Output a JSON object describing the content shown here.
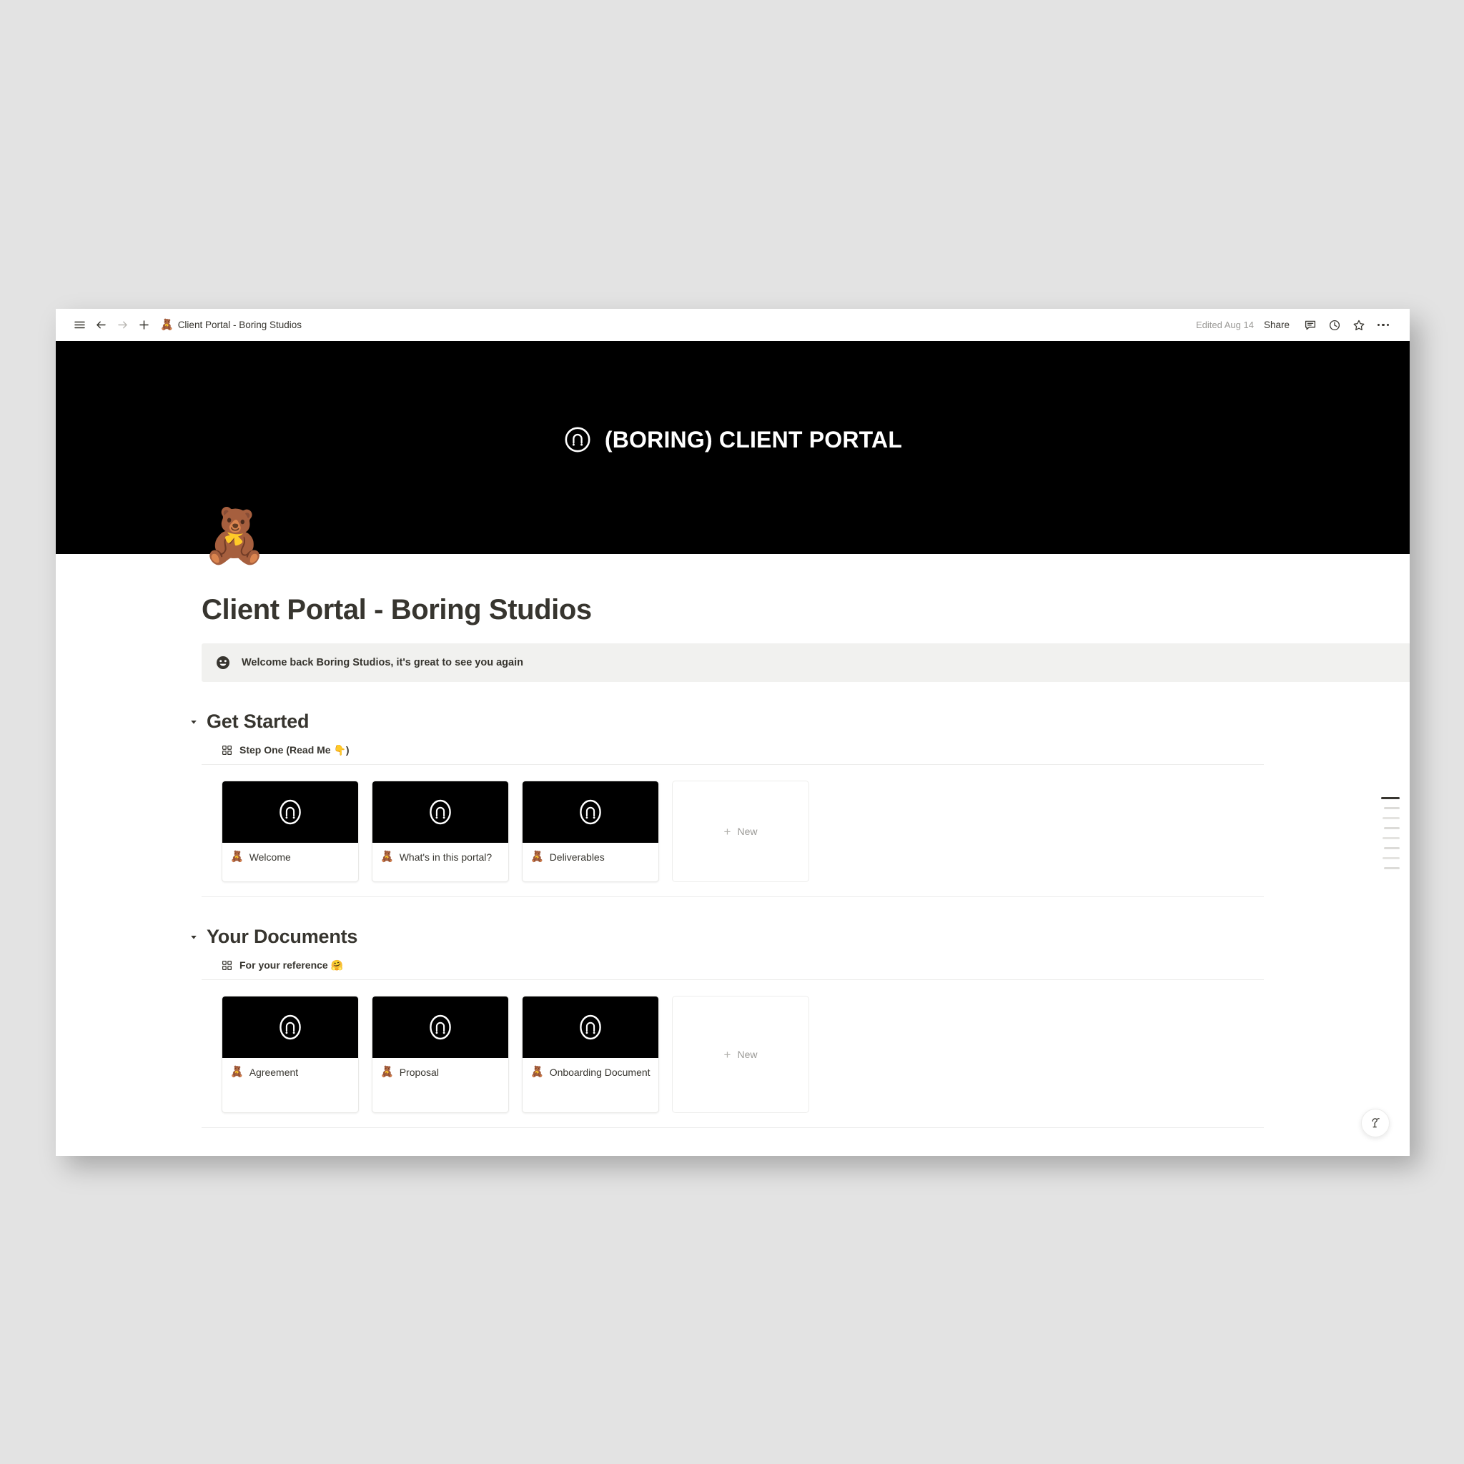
{
  "topbar": {
    "menu_icon": "hamburger-menu-icon",
    "back_icon": "arrow-left-icon",
    "forward_icon": "arrow-right-icon",
    "new_icon": "plus-icon",
    "breadcrumb_emoji": "🧸",
    "breadcrumb_title": "Client Portal - Boring Studios",
    "edited_label": "Edited Aug 14",
    "share_label": "Share",
    "comment_icon": "comment-icon",
    "history_icon": "clock-history-icon",
    "favorite_icon": "star-icon",
    "more_icon": "more-options-icon"
  },
  "cover": {
    "brand_title": "(BORING) CLIENT PORTAL",
    "logo_icon": "boring-studios-logo-icon",
    "background_color": "#000000"
  },
  "page": {
    "emoji": "🧸",
    "title": "Client Portal - Boring Studios",
    "callout": {
      "icon": "smiley-face-icon",
      "text": "Welcome back Boring Studios, it's great to see you again",
      "background_color": "#f1f1ef"
    }
  },
  "sections": [
    {
      "title": "Get Started",
      "caret_icon": "caret-down-icon",
      "database": {
        "view_icon": "gallery-view-icon",
        "view_label": "Step One (Read Me 👇)"
      },
      "cards": [
        {
          "emoji": "🧸",
          "label": "Welcome"
        },
        {
          "emoji": "🧸",
          "label": "What's in this portal?"
        },
        {
          "emoji": "🧸",
          "label": "Deliverables"
        }
      ],
      "new_card": {
        "plus": "+",
        "label": "New"
      }
    },
    {
      "title": "Your Documents",
      "caret_icon": "caret-down-icon",
      "database": {
        "view_icon": "gallery-view-icon",
        "view_label": "For your reference 🤗"
      },
      "cards": [
        {
          "emoji": "🧸",
          "label": "Agreement"
        },
        {
          "emoji": "🧸",
          "label": "Proposal"
        },
        {
          "emoji": "🧸",
          "label": "Onboarding Document"
        }
      ],
      "new_card": {
        "plus": "+",
        "label": "New"
      }
    }
  ],
  "toc": {
    "active_index": 0,
    "item_count": 8
  },
  "help_button": {
    "icon": "help-assistant-icon"
  },
  "colors": {
    "page_background": "#e3e3e3",
    "window_background": "#ffffff",
    "text_primary": "#37352f",
    "text_muted": "#9b9a97",
    "divider": "#ececeb"
  }
}
